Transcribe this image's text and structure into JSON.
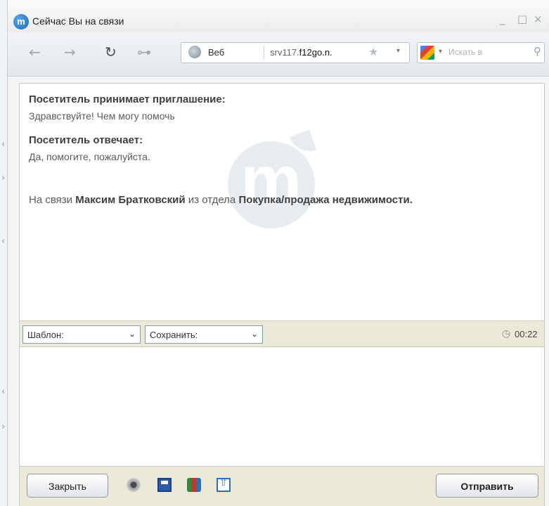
{
  "window": {
    "title": "Сейчас Вы на связи",
    "logo_letter": "m",
    "controls": {
      "minimize": "_",
      "maximize": "□",
      "close": "×"
    }
  },
  "toolbar": {
    "back_icon": "←",
    "forward_icon": "→",
    "reload_icon": "↻",
    "key_icon": "⊶",
    "address": {
      "label": "Веб",
      "url_prefix": "srv117.",
      "url_host": "f12go.n.",
      "star_icon": "★",
      "dropdown_icon": "▾"
    },
    "search": {
      "dropdown_icon": "▾",
      "placeholder": "Искать в",
      "icon": "⚲"
    }
  },
  "chat": {
    "messages": [
      {
        "heading": "Посетитель принимает приглашение:",
        "text": "Здравствуйте! Чем могу помочь"
      },
      {
        "heading": "Посетитель отвечает:",
        "text": "Да, помогите, пожалуйста."
      }
    ],
    "agent_notice": {
      "prefix": "На связи ",
      "agent_name": "Максим Братковский",
      "middle": " из отдела ",
      "department": "Покупка/продажа недвижимости",
      "suffix": "."
    },
    "watermark_letter": "m"
  },
  "controls": {
    "template_select": {
      "label": "Шаблон:",
      "chevron": "⌄"
    },
    "save_select": {
      "label": "Сохранить:",
      "chevron": "⌄"
    },
    "clock_icon": "◷",
    "timer": "00:22"
  },
  "message_input": {
    "value": ""
  },
  "bottom": {
    "close_button": "Закрыть",
    "send_button": "Отправить",
    "tool_icons": [
      "sound-icon",
      "save-icon",
      "users-icon",
      "upload-icon"
    ]
  },
  "colors": {
    "panel_beige": "#ece9d8",
    "select_border": "#7f9db9",
    "watermark": "#e7ecf1"
  }
}
